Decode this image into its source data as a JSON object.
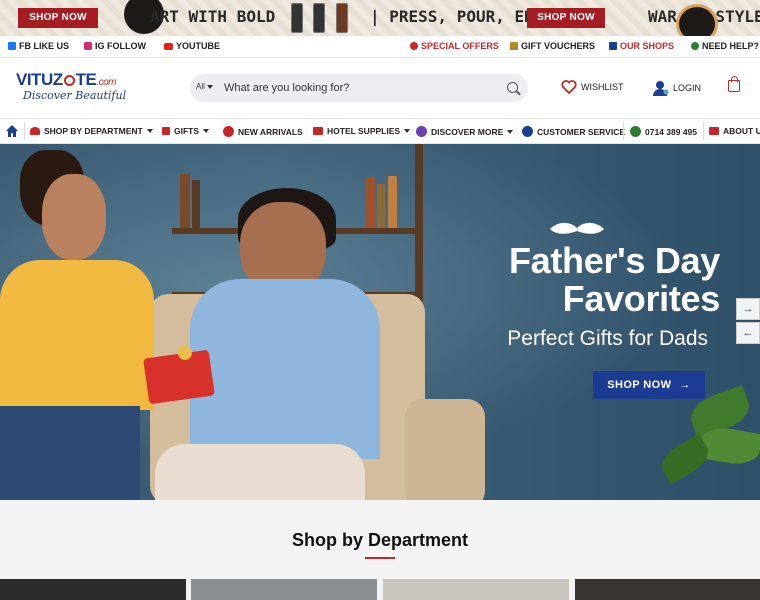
{
  "promo": {
    "shop_now_1": "SHOP NOW",
    "text_1": "ART WITH BOLD",
    "text_2": "| PRESS, POUR, ENJOY",
    "shop_now_2": "SHOP NOW",
    "text_3": "WAR    IN STYLE"
  },
  "social": {
    "fb": "FB LIKE US",
    "ig": "IG FOLLOW",
    "yt": "YOUTUBE",
    "offers": "SPECIAL OFFERS",
    "vouchers": "GIFT VOUCHERS",
    "shops": "OUR SHOPS",
    "help": "NEED HELP?"
  },
  "header": {
    "brand_a": "VITUZ",
    "brand_b": "TE",
    "brand_c": ".com",
    "tagline": "Discover Beautiful",
    "search_cat": "All",
    "search_placeholder": "What are you looking for?",
    "wishlist": "WISHLIST",
    "login": "LOGIN"
  },
  "nav": {
    "department": "SHOP BY DEPARTMENT",
    "gifts": "GIFTS",
    "new": "NEW ARRIVALS",
    "hotel": "HOTEL SUPPLIES",
    "discover": "DISCOVER MORE",
    "service": "CUSTOMER SERVICE",
    "phone": "0714 389 495",
    "about": "ABOUT U"
  },
  "hero": {
    "title_line1": "Father's Day",
    "title_line2": "Favorites",
    "subtitle": "Perfect Gifts for Dads",
    "cta": "SHOP NOW",
    "cta_arrow": "→",
    "next": "→",
    "prev": "←"
  },
  "section": {
    "title": "Shop by Department"
  },
  "colors": {
    "brand_red": "#c62828",
    "brand_blue": "#1b3f8f",
    "cta_blue": "#1c3b93",
    "promo_red": "#a51d22"
  }
}
